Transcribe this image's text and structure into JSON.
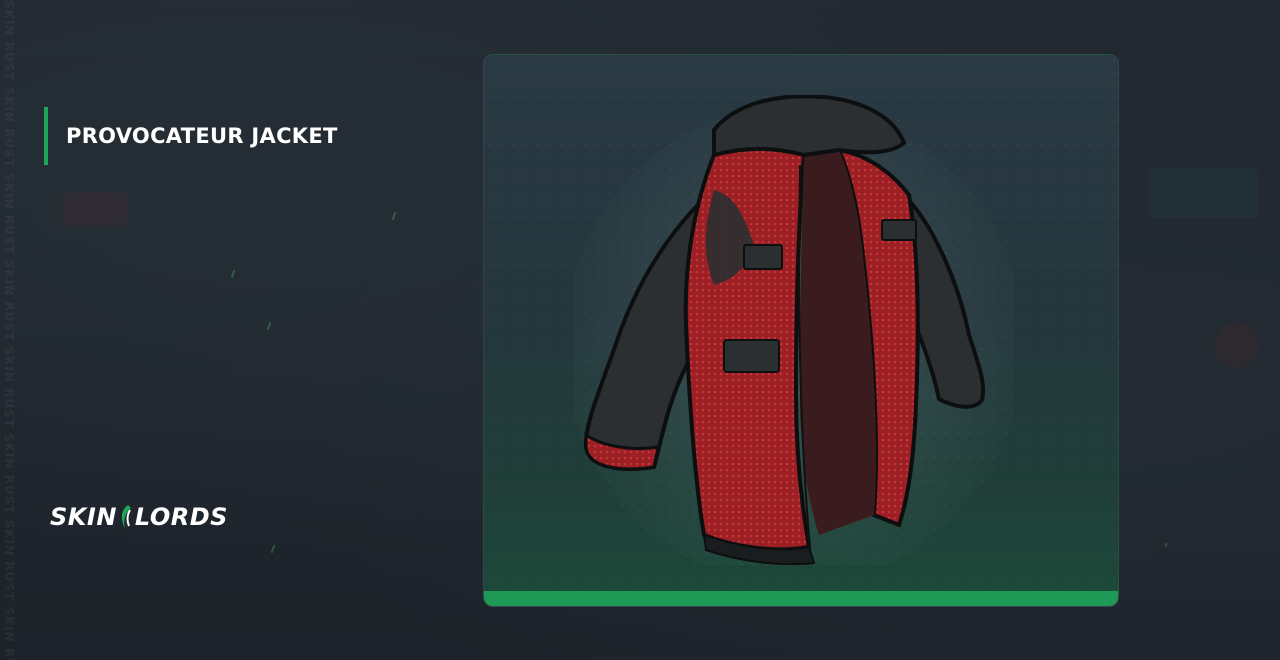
{
  "item": {
    "title": "PROVOCATEUR JACKET",
    "image_icon": "jacket-icon"
  },
  "brand": {
    "name_left": "SKIN",
    "name_right": "LORDS",
    "accent_color": "#1fa65a"
  },
  "background": {
    "watermark": "SKIN RUST SKIN RUST SKIN RUST SKIN RUST SKIN RUST SKIN RUST SKIN RUST SKIN RUST SKIN RUST"
  },
  "colors": {
    "background": "#1e242b",
    "card_bar": "#1f9a56",
    "jacket_red": "#9c1f24",
    "jacket_dark": "#2b2f31"
  }
}
